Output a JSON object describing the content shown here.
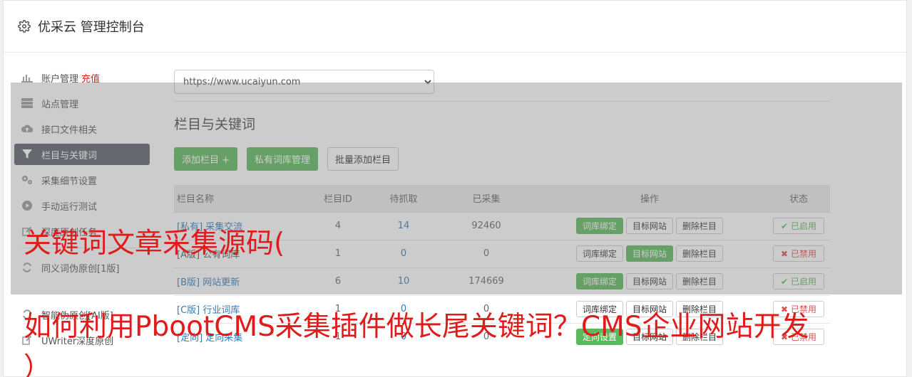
{
  "header": {
    "title": "优采云 管理控制台"
  },
  "sidebar": {
    "items": [
      {
        "label": "账户管理",
        "extra": "充值",
        "icon": "bar-chart-icon"
      },
      {
        "label": "站点管理",
        "icon": "server-icon"
      },
      {
        "label": "接口文件相关",
        "icon": "cloud-upload-icon"
      },
      {
        "label": "栏目与关键词",
        "icon": "filter-icon",
        "active": true
      },
      {
        "label": "采集细节设置",
        "icon": "gears-icon"
      },
      {
        "label": "手动运行测试",
        "icon": "play-circle-icon"
      },
      {
        "label": "深度原创任务",
        "icon": "edit-icon"
      }
    ],
    "items2": [
      {
        "label": "同义词伪原创[1版]",
        "icon": "refresh-icon"
      },
      {
        "label": "智能伪原创[AI版]",
        "icon": "refresh-icon"
      },
      {
        "label": "UWriter深度原创",
        "icon": "edit-icon"
      }
    ]
  },
  "main": {
    "site_select": {
      "selected": "https://www.ucaiyun.com"
    },
    "section_title": "栏目与关键词",
    "buttons": {
      "add": "添加栏目 +",
      "private": "私有词库管理",
      "batch": "批量添加栏目"
    },
    "table": {
      "headers": {
        "name": "栏目名称",
        "id": "栏目ID",
        "pending": "待抓取",
        "collected": "已采集",
        "ops": "操作",
        "status": "状态"
      },
      "rows": [
        {
          "tag": "[私有]",
          "name": "采集交流",
          "id": "4",
          "pending": "14",
          "collected": "92460",
          "op1": "词库绑定",
          "op2": "目标网站",
          "op3": "删除栏目",
          "status": "已启用",
          "on": true,
          "op1_green": true,
          "op2_green": false
        },
        {
          "tag": "[A版]",
          "name": "公有词库",
          "id": "1",
          "pending": "0",
          "collected": "0",
          "op1": "词库绑定",
          "op2": "目标网站",
          "op3": "删除栏目",
          "status": "已禁用",
          "on": false,
          "op1_green": false,
          "op2_green": true
        },
        {
          "tag": "[B版]",
          "name": "网站更新",
          "id": "6",
          "pending": "10",
          "collected": "174669",
          "op1": "词库绑定",
          "op2": "目标网站",
          "op3": "删除栏目",
          "status": "已启用",
          "on": true,
          "op1_green": true,
          "op2_green": false
        },
        {
          "tag": "[C版]",
          "name": "行业词库",
          "id": "1",
          "pending": "0",
          "collected": "0",
          "op1": "词库绑定",
          "op2": "目标网站",
          "op3": "删除栏目",
          "status": "已禁用",
          "on": false,
          "op1_green": false,
          "op2_green": false
        },
        {
          "tag": "[定向]",
          "name": "定向采集",
          "id": "1",
          "pending": "0",
          "collected": "0",
          "op1": "定向设置",
          "op2": "目标网站",
          "op3": "删除栏目",
          "status": "已禁用",
          "on": false,
          "op1_green": true,
          "op2_green": false
        }
      ]
    }
  },
  "overlay": {
    "caption1": "关键词文章采集源码(",
    "caption2": "如何利用PbootCMS采集插件做长尾关键词？CMS企业网站开发",
    "caption3": "）"
  },
  "colors": {
    "accent_green": "#5cb85c",
    "active_nav": "#595f69",
    "caption_red": "#e01b1b"
  }
}
